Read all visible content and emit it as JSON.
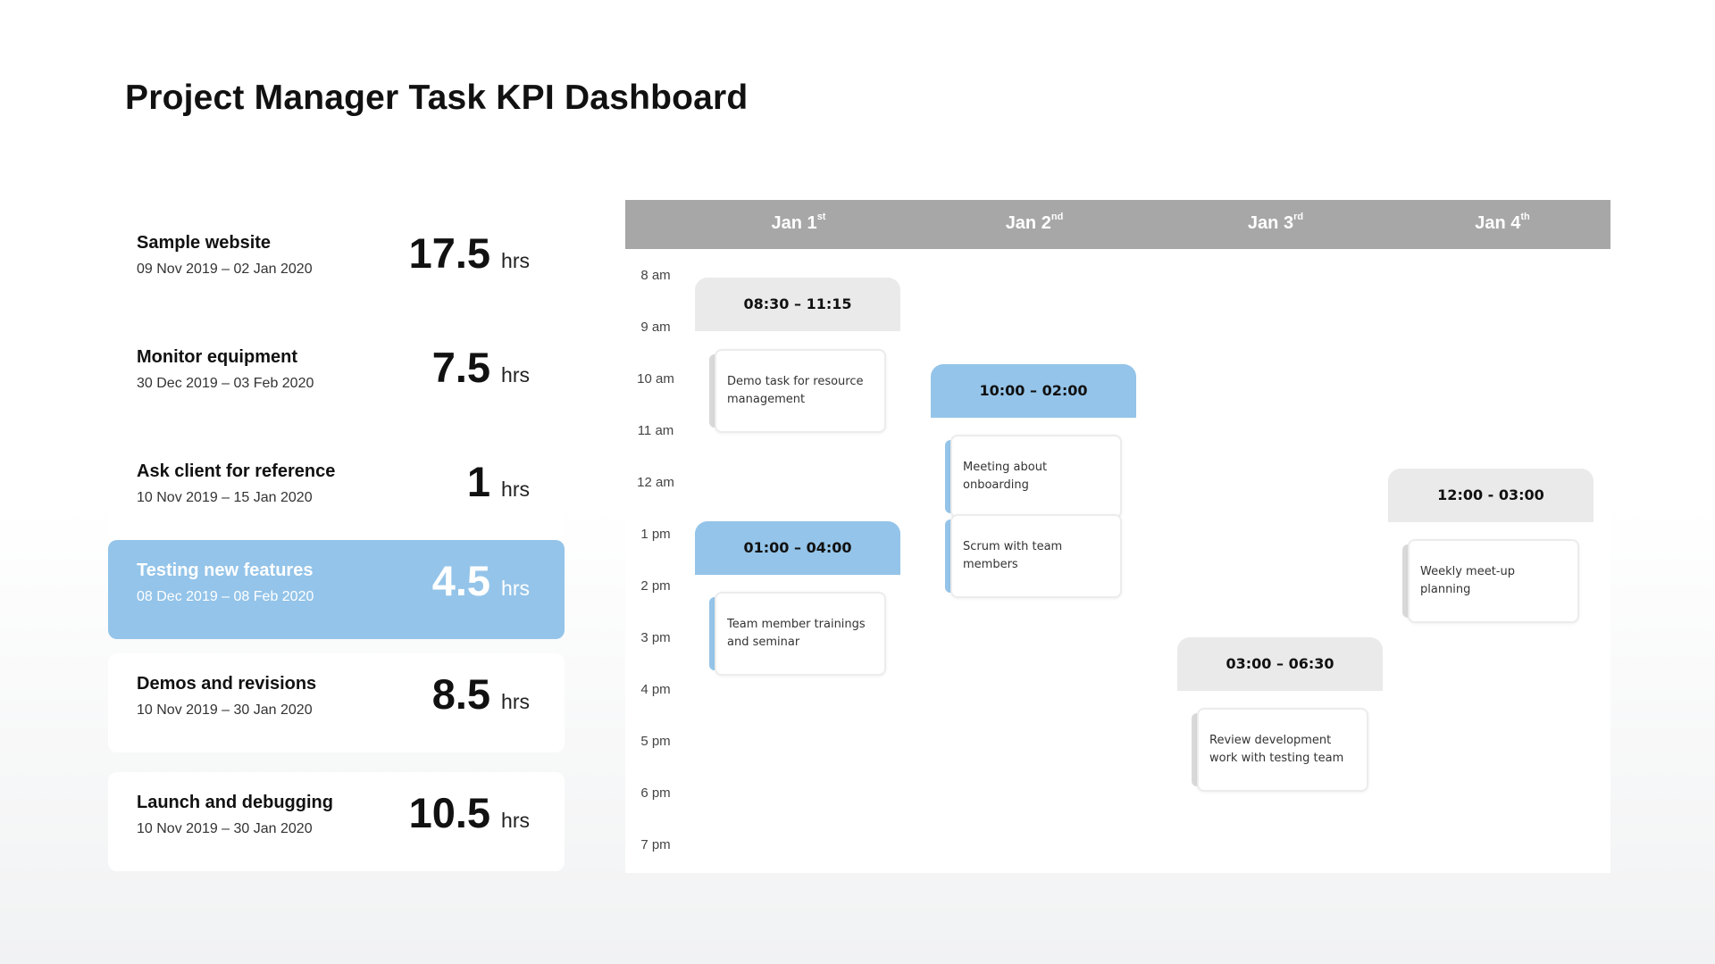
{
  "title": "Project Manager Task KPI Dashboard",
  "tasks": [
    {
      "name": "Sample website",
      "dates": "09 Nov 2019 – 02 Jan 2020",
      "hours": "17.5",
      "unit": "hrs"
    },
    {
      "name": "Monitor equipment",
      "dates": "30 Dec 2019 – 03 Feb 2020",
      "hours": "7.5",
      "unit": "hrs"
    },
    {
      "name": "Ask client for reference",
      "dates": "10 Nov 2019 – 15 Jan 2020",
      "hours": "1",
      "unit": "hrs"
    },
    {
      "name": "Testing new features",
      "dates": "08 Dec 2019 – 08 Feb 2020",
      "hours": "4.5",
      "unit": "hrs",
      "highlighted": true
    },
    {
      "name": "Demos and revisions",
      "dates": "10 Nov 2019 – 30 Jan 2020",
      "hours": "8.5",
      "unit": "hrs"
    },
    {
      "name": "Launch and debugging",
      "dates": "10 Nov 2019 – 30 Jan 2020",
      "hours": "10.5",
      "unit": "hrs"
    }
  ],
  "calendar": {
    "days": [
      {
        "label": "Jan 1",
        "suffix": "st"
      },
      {
        "label": "Jan 2",
        "suffix": "nd"
      },
      {
        "label": "Jan 3",
        "suffix": "rd"
      },
      {
        "label": "Jan 4",
        "suffix": "th"
      }
    ],
    "times": [
      "8 am",
      "9 am",
      "10 am",
      "11 am",
      "12 am",
      "1 pm",
      "2 pm",
      "3 pm",
      "4 pm",
      "5 pm",
      "6 pm",
      "7 pm"
    ],
    "slots": [
      {
        "range": "08:30 – 11:15",
        "style": "gray"
      },
      {
        "range": "10:00 – 02:00",
        "style": "blue"
      },
      {
        "range": "12:00 - 03:00",
        "style": "gray"
      },
      {
        "range": "01:00 – 04:00",
        "style": "blue"
      },
      {
        "range": "03:00 – 06:30",
        "style": "gray"
      }
    ],
    "notes": [
      {
        "text": "Demo task for resource management",
        "style": "gray"
      },
      {
        "text": "Meeting about onboarding",
        "style": "blue"
      },
      {
        "text": "Scrum with team members",
        "style": "blue"
      },
      {
        "text": "Weekly meet-up planning",
        "style": "gray"
      },
      {
        "text": "Team member trainings and seminar",
        "style": "blue"
      },
      {
        "text": "Review development work with testing team",
        "style": "gray"
      }
    ],
    "colors": {
      "header": "#a7a7a7",
      "accent_blue": "#94c4e9",
      "slot_gray": "#eaeaea"
    }
  }
}
